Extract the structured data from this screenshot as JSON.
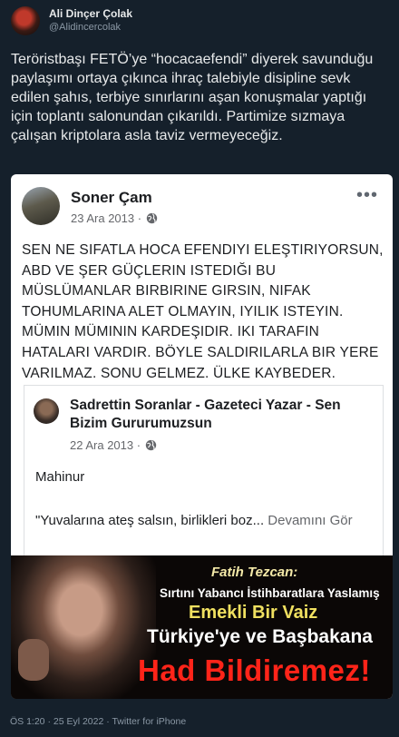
{
  "tweet": {
    "author_name": "Ali Dinçer Çolak",
    "author_handle": "@Alidincercolak",
    "text": "Teröristbaşı FETÖ’ye “hocacaefendi” diyerek savunduğu paylaşımı ortaya çıkınca ihraç talebiyle disipline sevk edilen şahıs, terbiye sınırlarını aşan konuşmalar yaptığı için toplantı salonundan çıkarıldı. Partimize sızmaya çalışan kriptolara asla taviz vermeyeceğiz.",
    "footer": "ÖS 1:20 · 25 Eyl 2022 · Twitter for iPhone"
  },
  "embed": {
    "post_author": "Soner Çam",
    "post_date": "23 Ara 2013 ·",
    "more_menu": "•••",
    "post_text": "SEN NE SIFATLA HOCA EFENDIYI ELEŞTIRIYORSUN, ABD VE ŞER GÜÇLERIN ISTEDIĞI BU MÜSLÜMANLAR BIRBIRINE GIRSIN, NIFAK TOHUMLARINA ALET OLMAYIN, IYILIK ISTEYIN. MÜMIN MÜMININ KARDEŞIDIR. IKI TARAFIN HATALARI VARDIR. BÖYLE SALDIRILARLA BIR YERE VARILMAZ. SONU GELMEZ. ÜLKE KAYBEDER.",
    "shared_author": "Sadrettin Soranlar - Gazeteci  Yazar - Sen Bizim Gururumuzsun",
    "shared_date": "22 Ara 2013 ·",
    "shared_text": "Mahinur",
    "shared_quote": "\"Yuvalarına ateş salsın, birlikleri boz...",
    "see_more": "Devamını Gör",
    "banner": {
      "line1": "Fatih Tezcan:",
      "line2": "Sırtını Yabancı İstihbaratlara Yaslamış",
      "line3": "Emekli Bir Vaiz",
      "line4": "Türkiye'ye ve Başbakana",
      "line5": "Had Bildiremez!"
    }
  },
  "icons": {
    "privacy": "globe-icon",
    "menu": "more-dots-icon"
  }
}
